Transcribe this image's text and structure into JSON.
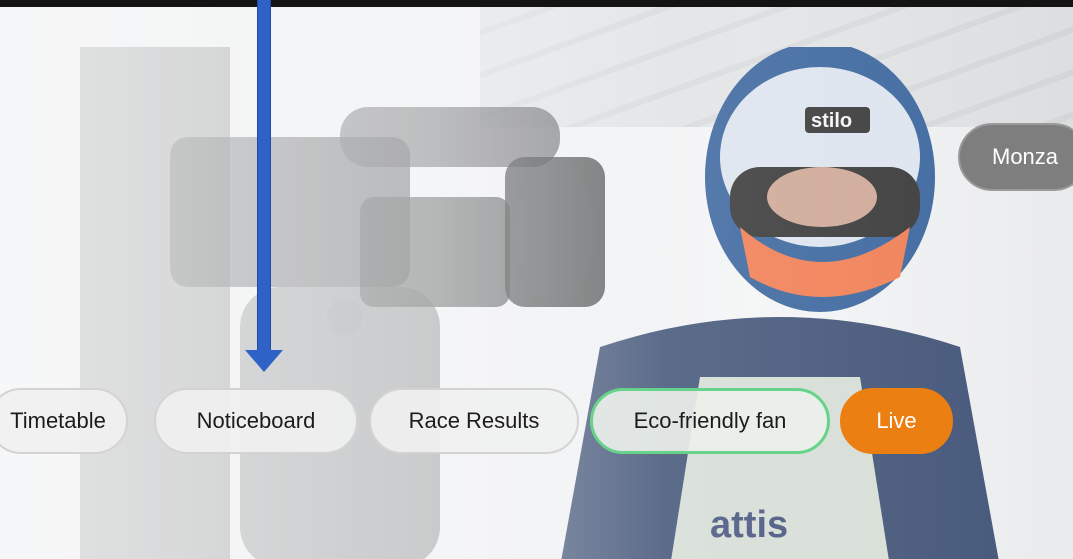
{
  "nav": {
    "timetable": "Timetable",
    "noticeboard": "Noticeboard",
    "race_results": "Race Results",
    "eco_friendly_fan": "Eco-friendly fan",
    "live": "Live"
  },
  "event": {
    "name": "Monza"
  },
  "colors": {
    "live_accent": "#ec7f12",
    "eco_border": "#67d38a",
    "annotation_arrow": "#2f62c7"
  },
  "annotation": {
    "type": "arrow-down",
    "target": "noticeboard"
  }
}
